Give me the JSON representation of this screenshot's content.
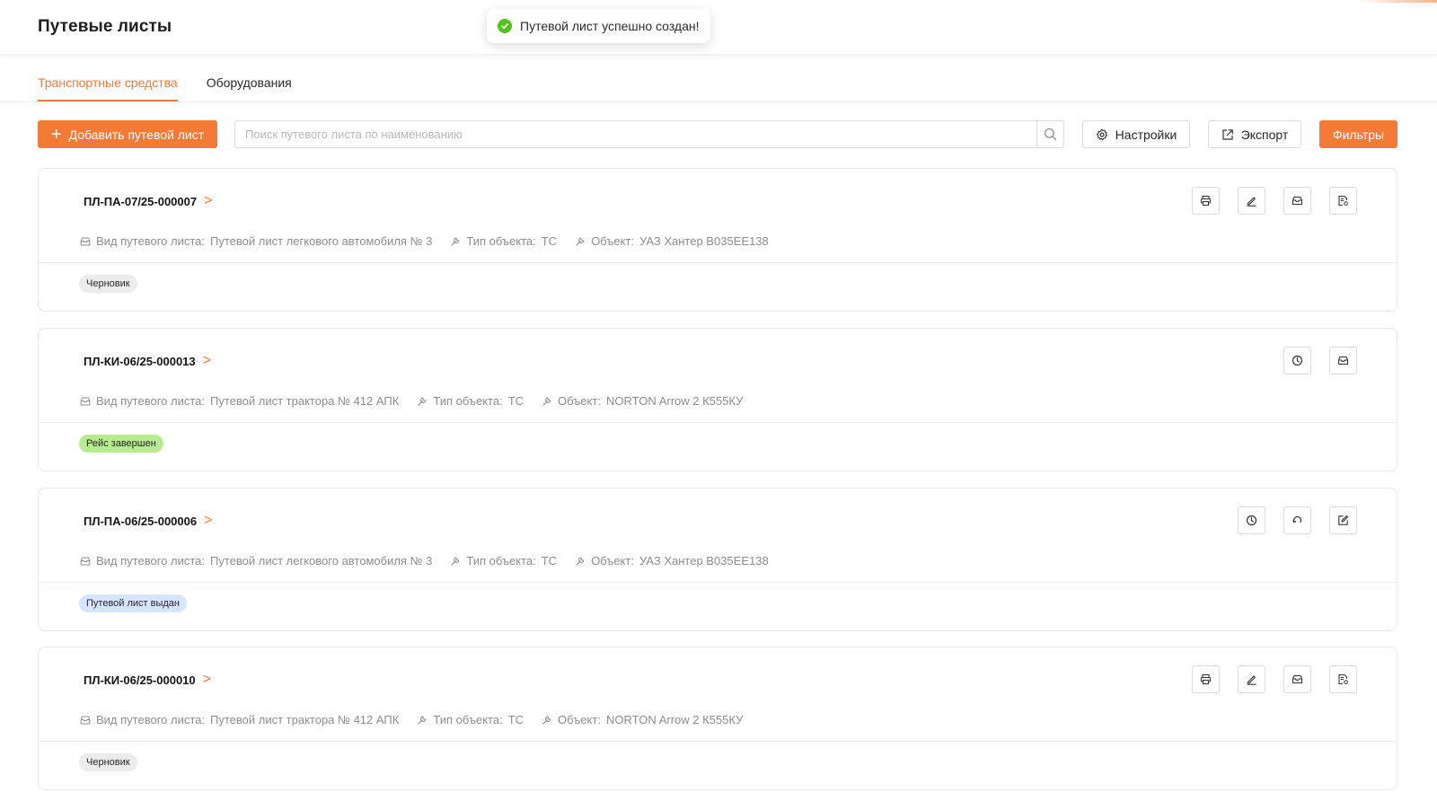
{
  "header": {
    "title": "Путевые листы"
  },
  "toast": {
    "message": "Путевой лист успешно создан!",
    "status_color": "#52c41a"
  },
  "tabs": [
    {
      "label": "Транспортные средства",
      "active": true
    },
    {
      "label": "Оборудования",
      "active": false
    }
  ],
  "toolbar": {
    "add_label": "Добавить путевой лист",
    "search_placeholder": "Поиск путевого листа по наименованию",
    "search_value": "",
    "settings_label": "Настройки",
    "export_label": "Экспорт",
    "filters_label": "Фильтры"
  },
  "colors": {
    "accent": "#f47a36"
  },
  "meta_labels": {
    "type": "Вид путевого листа:",
    "object_type": "Тип объекта:",
    "object": "Объект:"
  },
  "cards": [
    {
      "title": "ПЛ-ПА-07/25-000007",
      "type": "Путевой лист легкового автомобиля № 3",
      "object_type": "ТС",
      "object": "УАЗ Хантер В035ЕЕ138",
      "status": "Черновик",
      "status_kind": "draft",
      "actions": [
        "printer-icon",
        "edit-icon",
        "archive-icon",
        "document-settings-icon"
      ]
    },
    {
      "title": "ПЛ-КИ-06/25-000013",
      "type": "Путевой лист трактора № 412 АПК",
      "object_type": "ТС",
      "object": "NORTON Arrow 2 К555КУ",
      "status": "Рейс завершен",
      "status_kind": "done",
      "actions": [
        "clock-icon",
        "archive-icon"
      ]
    },
    {
      "title": "ПЛ-ПА-06/25-000006",
      "type": "Путевой лист легкового автомобиля № 3",
      "object_type": "ТС",
      "object": "УАЗ Хантер В035ЕЕ138",
      "status": "Путевой лист выдан",
      "status_kind": "issued",
      "actions": [
        "clock-icon",
        "refresh-icon",
        "edit-document-icon"
      ]
    },
    {
      "title": "ПЛ-КИ-06/25-000010",
      "type": "Путевой лист трактора № 412 АПК",
      "object_type": "ТС",
      "object": "NORTON Arrow 2 К555КУ",
      "status": "Черновик",
      "status_kind": "draft",
      "actions": [
        "printer-icon",
        "edit-icon",
        "archive-icon",
        "document-settings-icon"
      ]
    }
  ]
}
